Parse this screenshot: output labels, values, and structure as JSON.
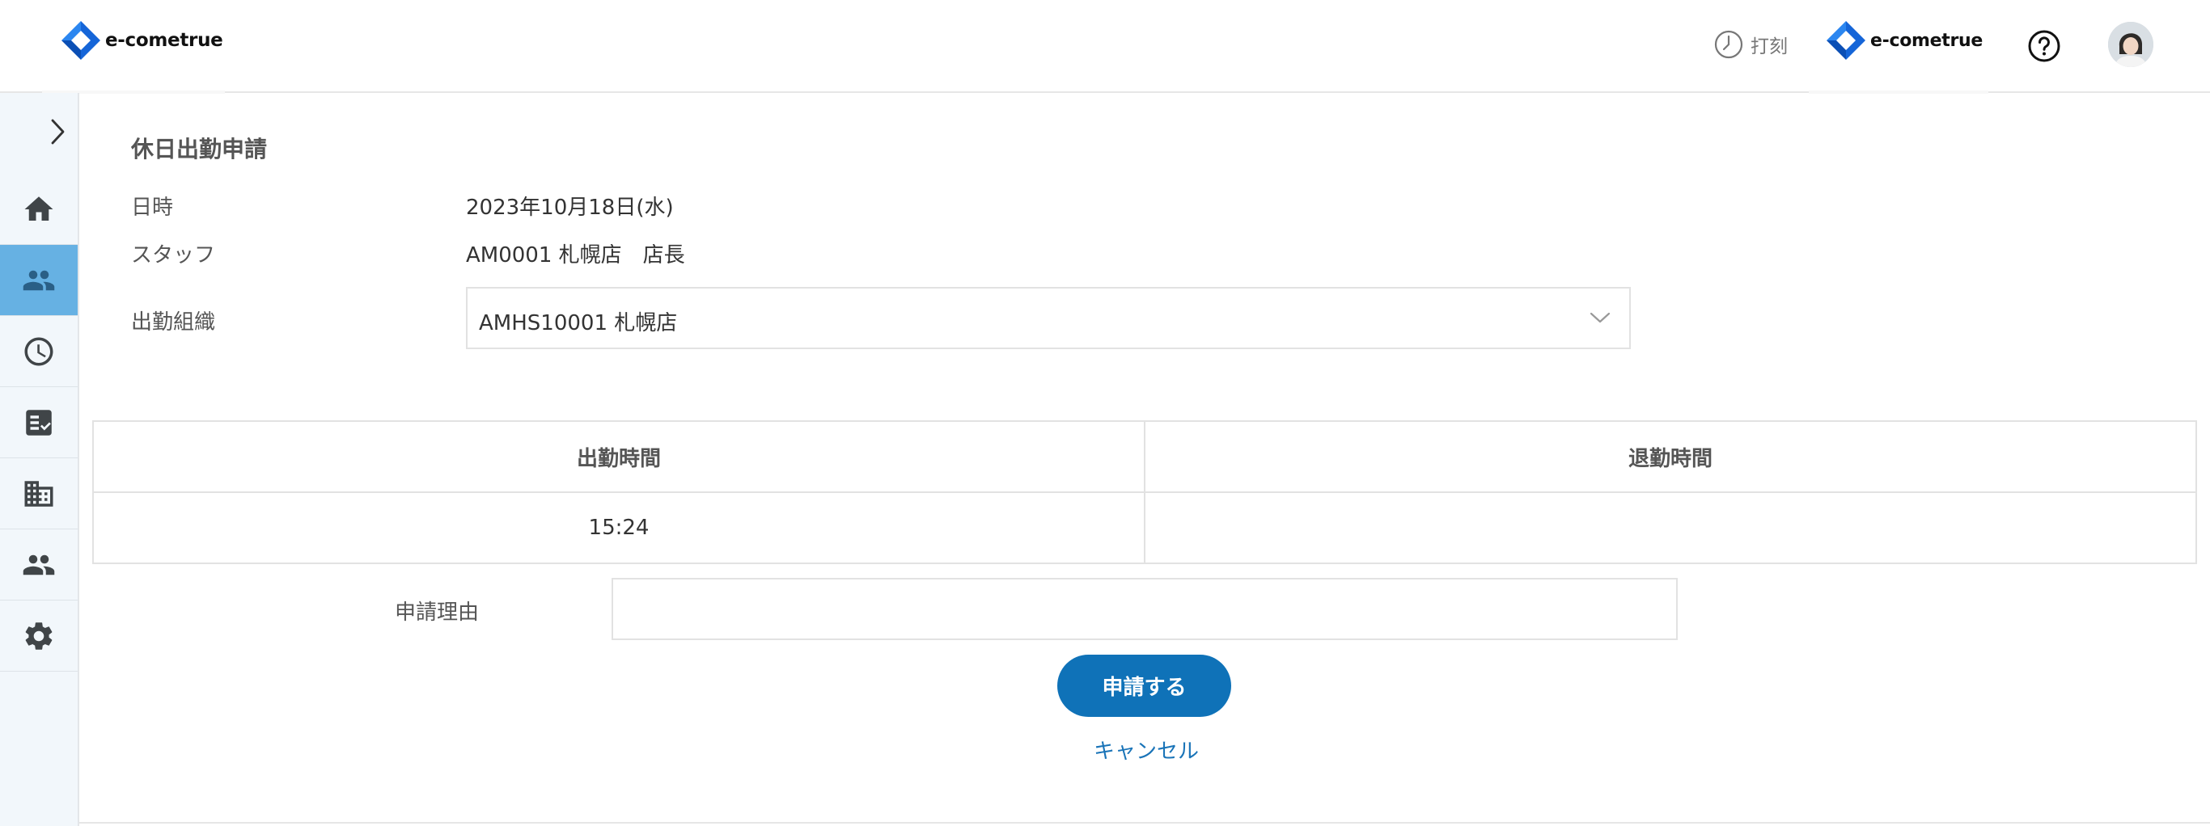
{
  "header": {
    "logo_text": "e-cometrue",
    "partner_logo_text": "e-cometrue",
    "punch_label": "打刻"
  },
  "sidebar": {
    "items": [
      {
        "icon": "home-icon"
      },
      {
        "icon": "people-icon",
        "active": true
      },
      {
        "icon": "clock-icon"
      },
      {
        "icon": "checklist-icon"
      },
      {
        "icon": "building-icon"
      },
      {
        "icon": "group-icon"
      },
      {
        "icon": "gear-icon"
      }
    ]
  },
  "form": {
    "title": "休日出勤申請",
    "datetime_label": "日時",
    "datetime_value": "2023年10月18日(水)",
    "staff_label": "スタッフ",
    "staff_value": "AM0001 札幌店　店長",
    "org_label": "出勤組織",
    "org_value": "AMHS10001 札幌店",
    "table": {
      "headers": [
        "出勤時間",
        "退勤時間"
      ],
      "row": [
        "15:24",
        ""
      ]
    },
    "reason_label": "申請理由",
    "reason_value": "",
    "submit_label": "申請する",
    "cancel_label": "キャンセル"
  },
  "colors": {
    "primary": "#0f72b8",
    "sidebar_bg": "#f2f7fb",
    "sidebar_active": "#66b1e3",
    "logo_blue": "#1565d8"
  }
}
